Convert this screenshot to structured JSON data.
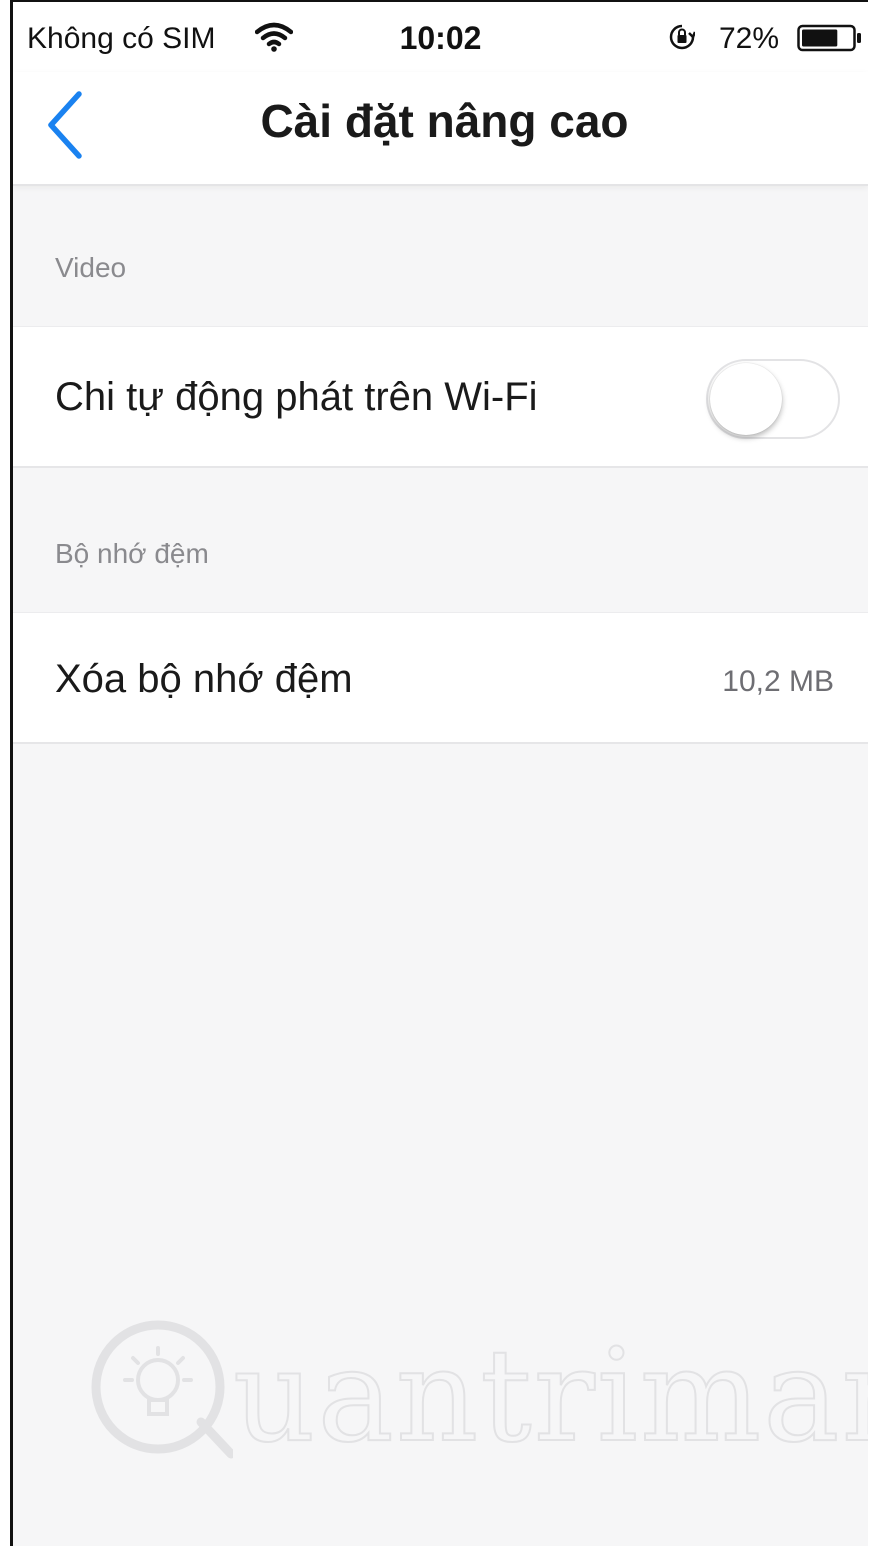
{
  "status_bar": {
    "carrier": "Không có SIM",
    "time": "10:02",
    "battery_percent": "72%",
    "battery_level": 0.72,
    "icons": [
      "wifi-icon",
      "orientation-lock-icon",
      "battery-icon"
    ]
  },
  "nav": {
    "back_icon": "chevron-left-icon",
    "title": "Cài đặt nâng cao"
  },
  "sections": {
    "video": {
      "header": "Video",
      "autoplay_label": "Chi tự động phát trên Wi-Fi",
      "autoplay_enabled": false
    },
    "cache": {
      "header": "Bộ nhớ đệm",
      "clear_label": "Xóa bộ nhớ đệm",
      "size": "10,2 MB"
    }
  },
  "watermark": {
    "text": "uantrimang"
  },
  "colors": {
    "accent": "#1a82f0",
    "background": "#f6f6f7",
    "surface": "#ffffff",
    "secondary_text": "#8a8a8e"
  }
}
